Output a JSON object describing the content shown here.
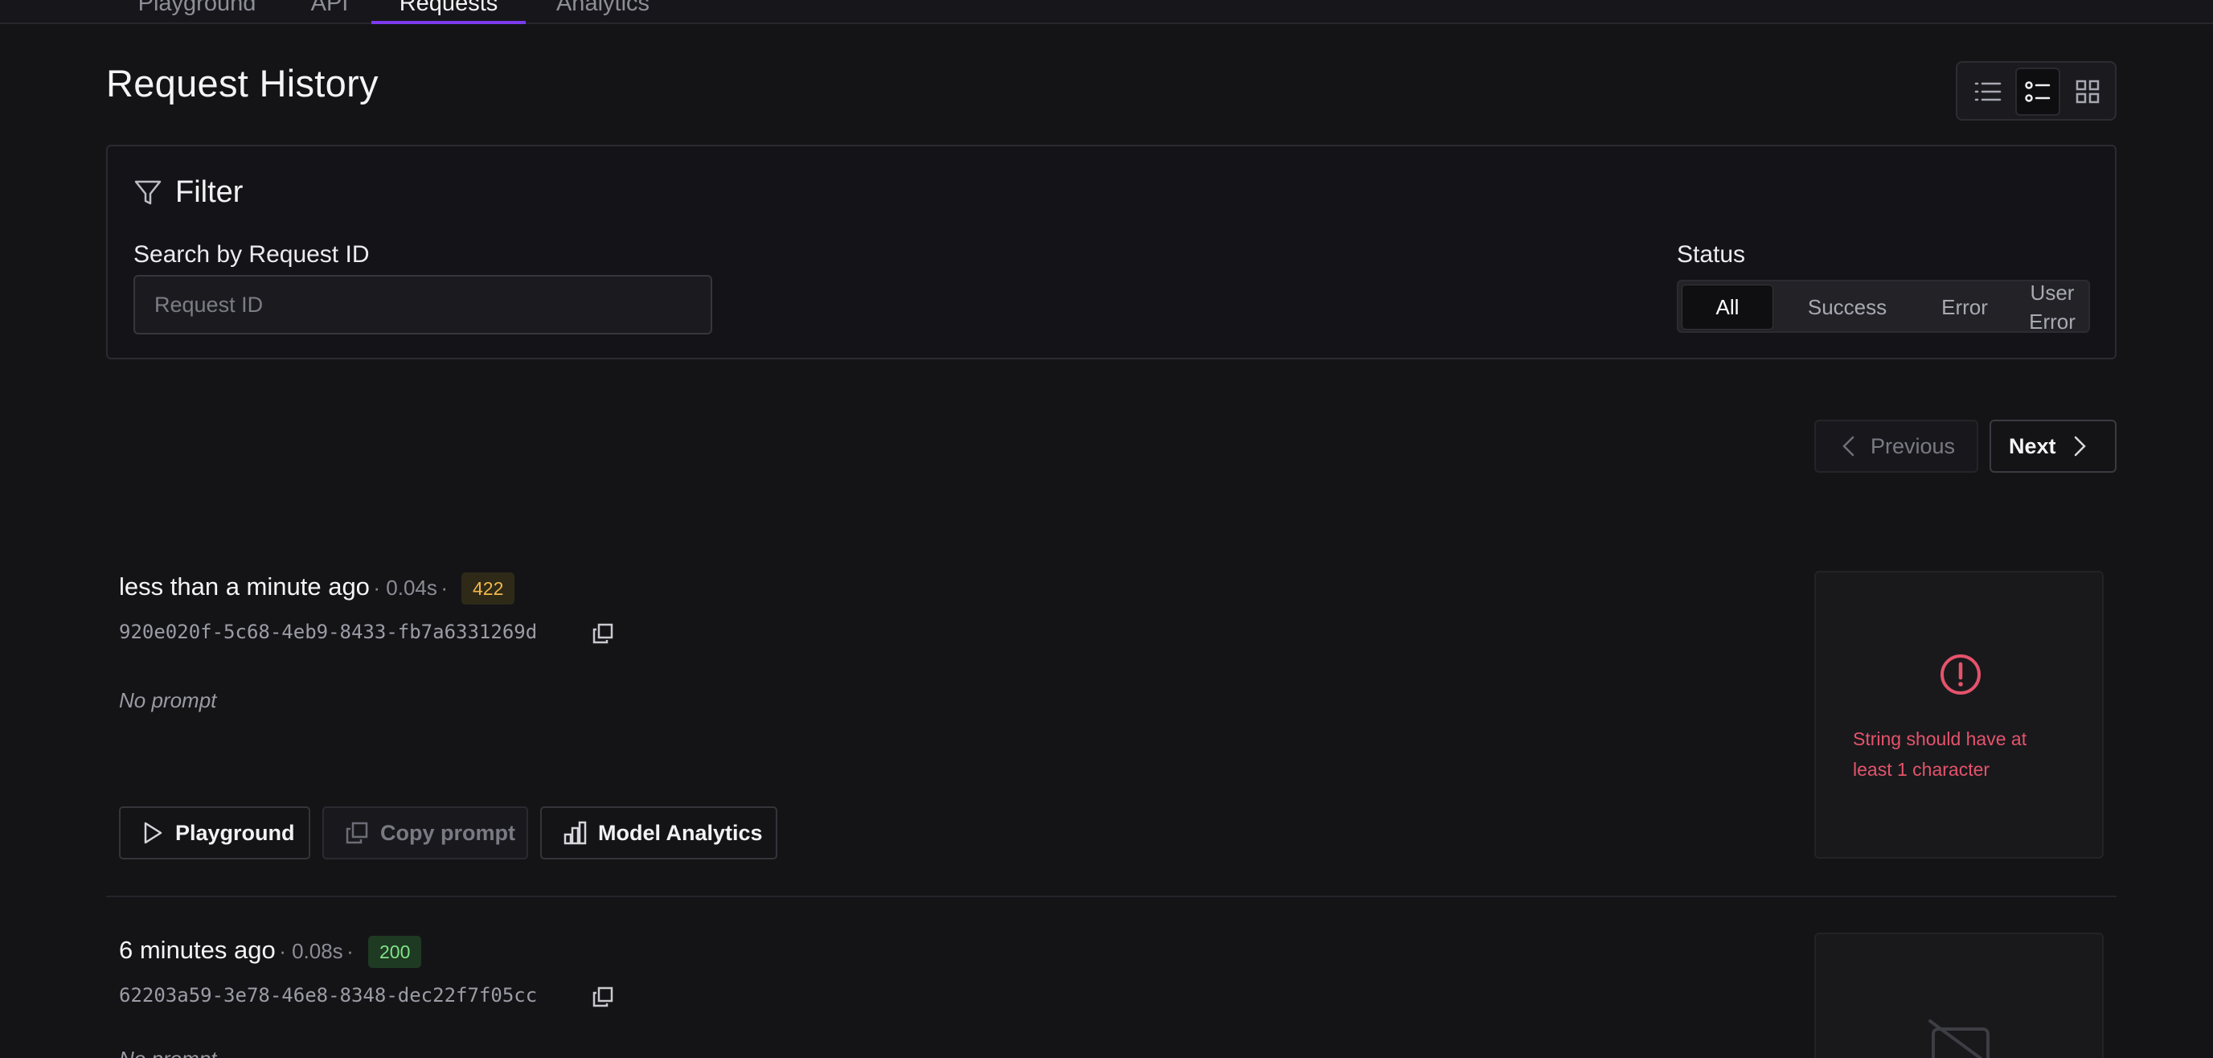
{
  "nav": {
    "tabs": [
      {
        "label": "Playground"
      },
      {
        "label": "API"
      },
      {
        "label": "Requests"
      },
      {
        "label": "Analytics"
      }
    ],
    "active_tab": "Requests",
    "accent_color": "#7c3aed"
  },
  "page": {
    "title": "Request History"
  },
  "view_toggle": {
    "options": [
      "list-icon",
      "detailed-list-icon",
      "grid-icon"
    ],
    "selected": "detailed-list-icon"
  },
  "filter": {
    "title": "Filter",
    "search_label": "Search by Request ID",
    "search_placeholder": "Request ID",
    "search_value": "",
    "status_label": "Status",
    "status_options": [
      "All",
      "Success",
      "Error",
      "User\nError"
    ],
    "status_selected": "All"
  },
  "pagination": {
    "previous_label": "Previous",
    "next_label": "Next"
  },
  "requests": [
    {
      "time": "less than a minute ago",
      "duration": "0.04s",
      "status_code": "422",
      "status_color": "#f0b84a",
      "request_id": "920e020f-5c68-4eb9-8433-fb7a6331269d",
      "prompt": "No prompt",
      "actions": {
        "playground": "Playground",
        "copy_prompt": "Copy prompt",
        "model_analytics": "Model Analytics"
      },
      "result": {
        "type": "error",
        "message": "String should have at least 1 character",
        "color": "#e5536b"
      }
    },
    {
      "time": "6 minutes ago",
      "duration": "0.08s",
      "status_code": "200",
      "status_color": "#7fe38a",
      "request_id": "62203a59-3e78-46e8-8348-dec22f7f05cc",
      "prompt": "No prompt",
      "result": {
        "type": "no-image"
      }
    }
  ]
}
